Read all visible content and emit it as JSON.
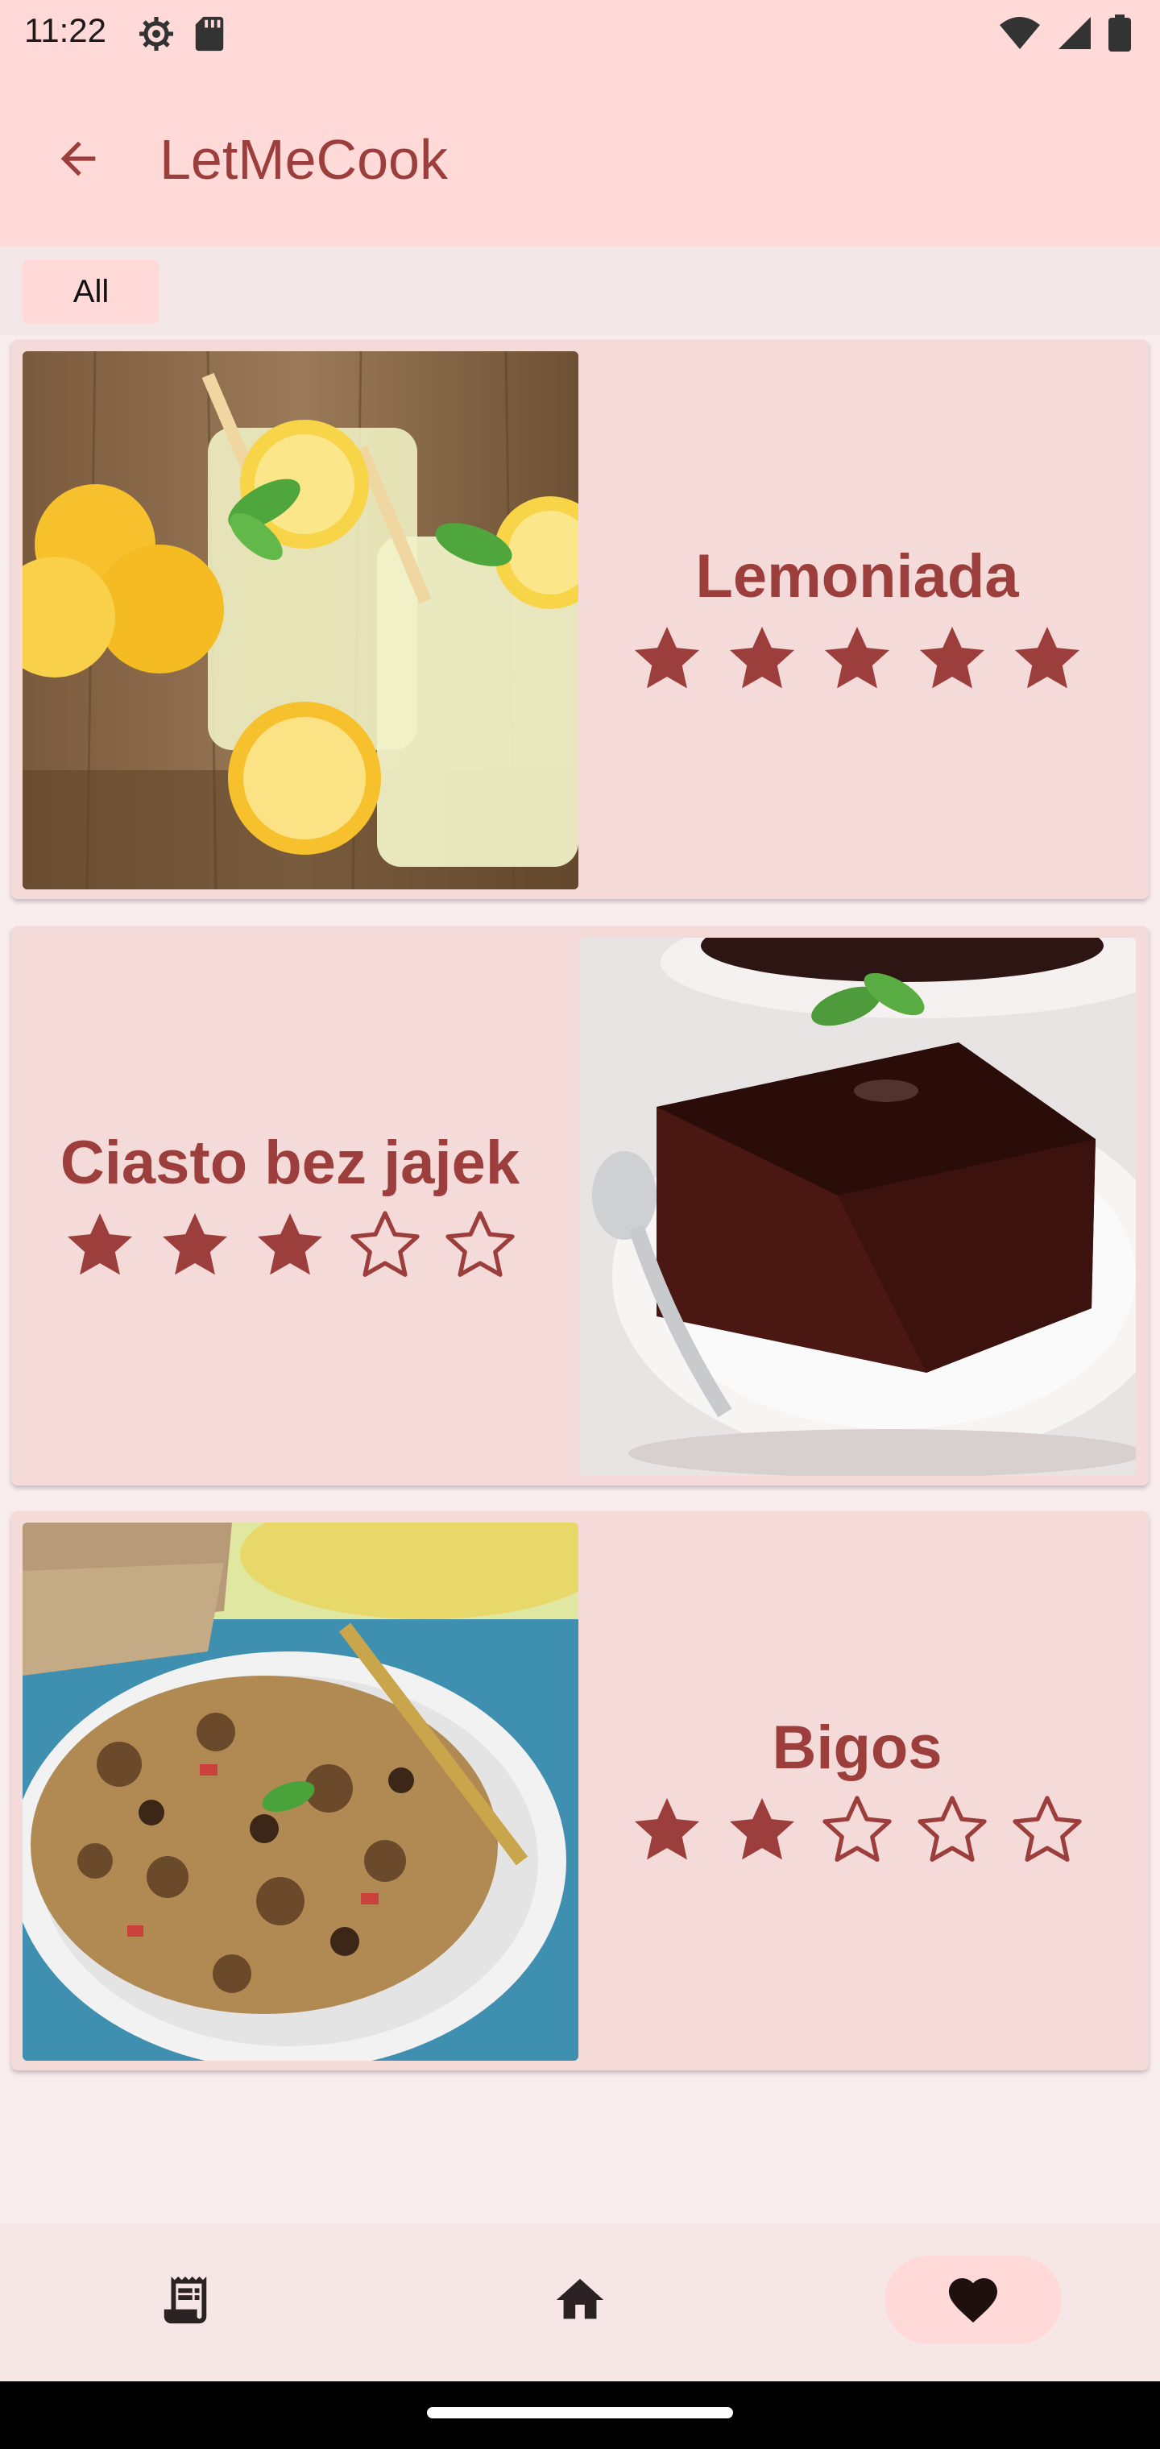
{
  "status": {
    "time": "11:22"
  },
  "app_bar": {
    "title": "LetMeCook"
  },
  "filter": {
    "chip_label": "All"
  },
  "recipes": [
    {
      "name": "Lemoniada",
      "rating": 5,
      "max_rating": 5
    },
    {
      "name": "Ciasto bez jajek",
      "rating": 3,
      "max_rating": 5
    },
    {
      "name": "Bigos",
      "rating": 2,
      "max_rating": 5
    }
  ],
  "bottom_nav": {
    "items": [
      "recipes-list-icon",
      "home-icon",
      "favorite-heart-icon"
    ],
    "active": "favorite-heart-icon"
  },
  "colors": {
    "accent": "#9b3e3c",
    "app_bar": "#ffdad8",
    "card": "#f4dbd9",
    "background": "#f8eced"
  }
}
